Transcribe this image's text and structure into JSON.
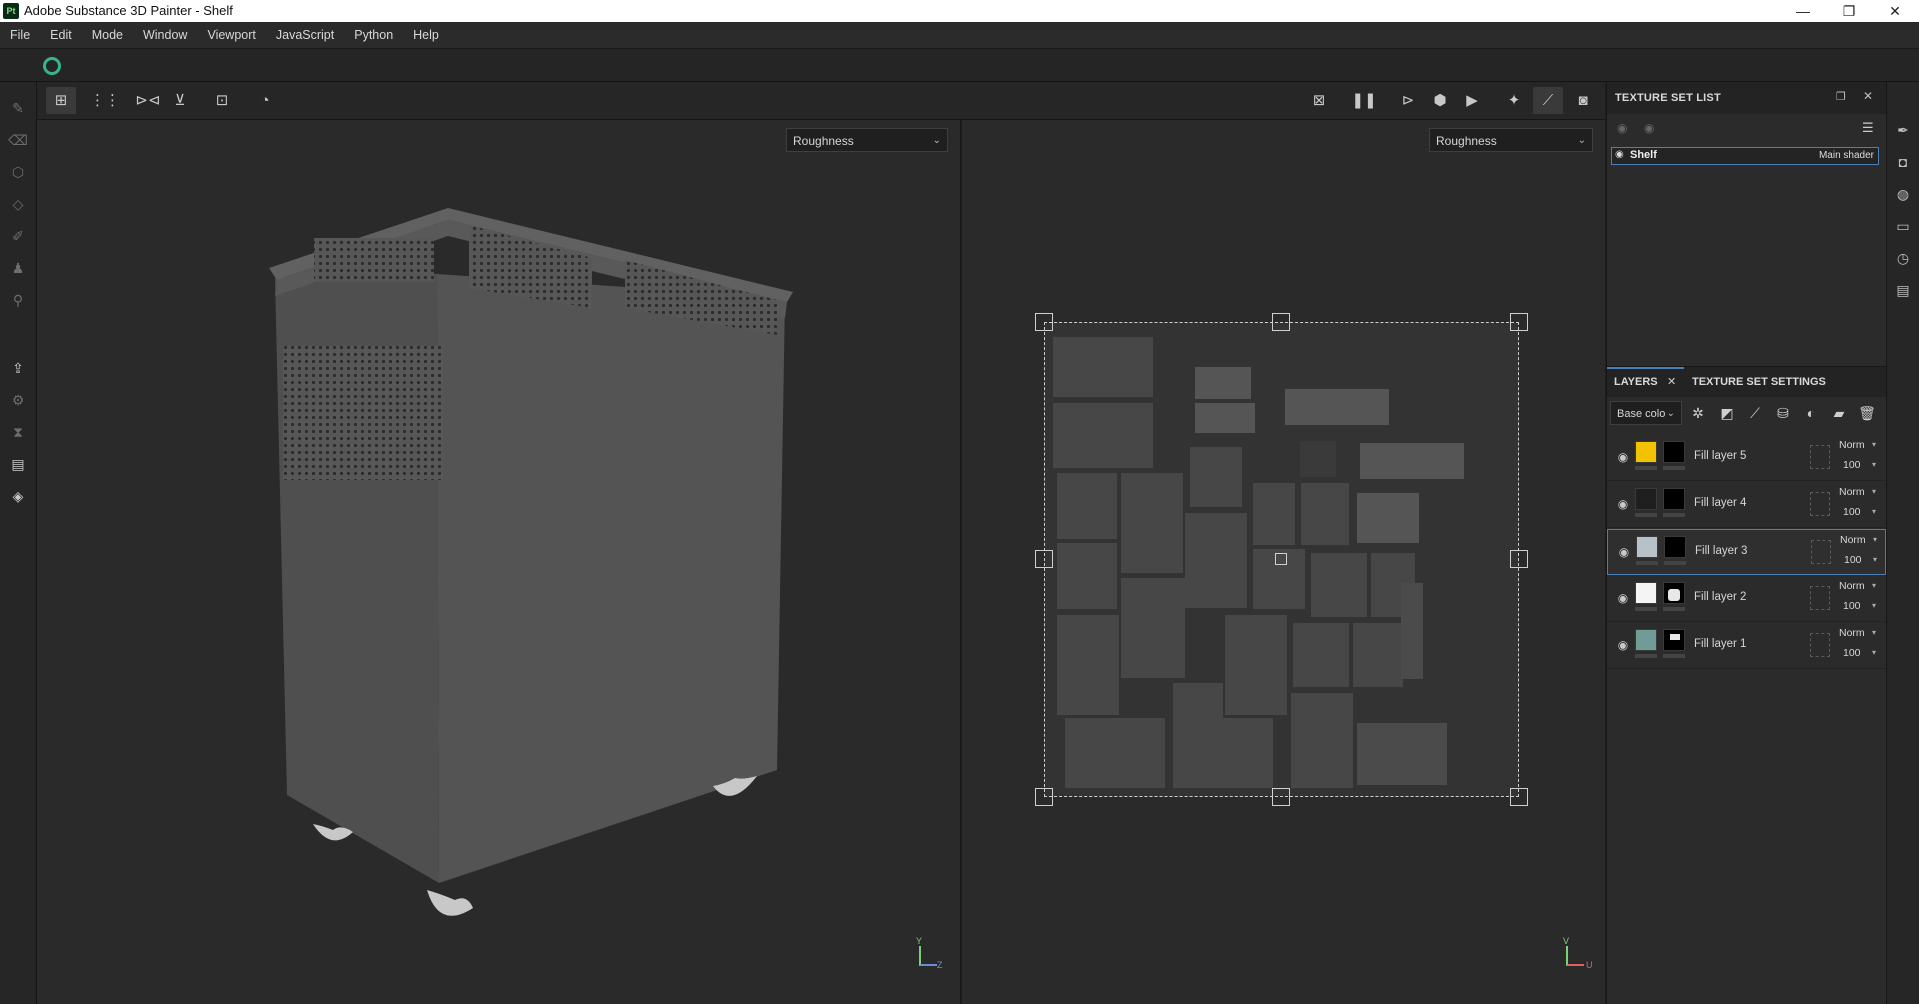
{
  "window": {
    "app_icon_text": "Pt",
    "title": "Adobe Substance 3D Painter - Shelf",
    "minimize": "—",
    "maximize": "❐",
    "close": "✕"
  },
  "menu": [
    "File",
    "Edit",
    "Mode",
    "Window",
    "Viewport",
    "JavaScript",
    "Python",
    "Help"
  ],
  "viewports": {
    "left_channel": "Roughness",
    "right_channel": "Roughness",
    "axis_3d": {
      "y": "Y",
      "z": "Z"
    },
    "axis_2d": {
      "v": "V",
      "u": "U"
    }
  },
  "texture_set_list": {
    "header": "TEXTURE SET LIST",
    "items": [
      {
        "name": "Shelf",
        "shader": "Main shader"
      }
    ]
  },
  "layers_panel": {
    "tabs": [
      "LAYERS",
      "TEXTURE SET SETTINGS"
    ],
    "channel_select": "Base colo",
    "layers": [
      {
        "name": "Fill layer 5",
        "blend": "Norm",
        "opacity": "100",
        "color": "#f2c200",
        "selected": false
      },
      {
        "name": "Fill layer 4",
        "blend": "Norm",
        "opacity": "100",
        "color": "#1f1f1f",
        "selected": false
      },
      {
        "name": "Fill layer 3",
        "blend": "Norm",
        "opacity": "100",
        "color": "#b6c1c9",
        "selected": true
      },
      {
        "name": "Fill layer 2",
        "blend": "Norm",
        "opacity": "100",
        "color": "#f4f4f4",
        "selected": false
      },
      {
        "name": "Fill layer 1",
        "blend": "Norm",
        "opacity": "100",
        "color": "#6f9c96",
        "selected": false
      }
    ]
  },
  "icons": {
    "viewport_toolbar_left": [
      "grid-3d-icon",
      "grid-2d-icon",
      "mirror-x-icon",
      "mirror-y-icon",
      "fit-icon",
      "history-icon"
    ],
    "viewport_toolbar_right": [
      "hide-uv-icon",
      "pause-icon",
      "display-icon",
      "cube-icon",
      "camera-icon",
      "light-icon",
      "brush-icon",
      "screenshot-icon"
    ],
    "colors": {
      "accent_blue": "#4a7fb5",
      "status_green": "#37b58a"
    }
  }
}
